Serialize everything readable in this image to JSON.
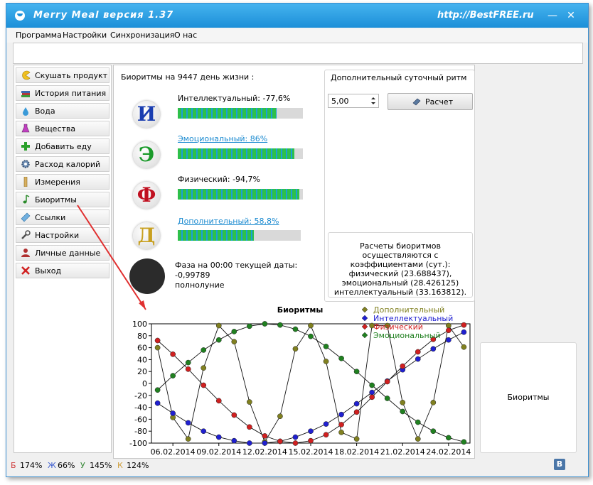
{
  "window": {
    "title": "Merry Meal версия 1.37",
    "watermark": "http://BestFREE.ru",
    "minimize_glyph": "—",
    "close_glyph": "✕"
  },
  "menu": [
    "Программа",
    "Настройки",
    "Синхронизация",
    "О нас"
  ],
  "sidebar": {
    "items": [
      {
        "label": "Скушать продукт",
        "icon": "pacman-icon"
      },
      {
        "label": "История питания",
        "icon": "books-icon"
      },
      {
        "label": "Вода",
        "icon": "water-drop-icon"
      },
      {
        "label": "Вещества",
        "icon": "flask-icon"
      },
      {
        "label": "Добавить еду",
        "icon": "plus-icon"
      },
      {
        "label": "Расход калорий",
        "icon": "gear-icon"
      },
      {
        "label": "Измерения",
        "icon": "ruler-icon"
      },
      {
        "label": "Биоритмы",
        "icon": "music-note-icon"
      },
      {
        "label": "Ссылки",
        "icon": "link-icon"
      },
      {
        "label": "Настройки",
        "icon": "wrench-icon"
      },
      {
        "label": "Личные данные",
        "icon": "user-icon"
      },
      {
        "label": "Выход",
        "icon": "close-x-icon"
      }
    ]
  },
  "biorhythms": {
    "heading": "Биоритмы на 9447 день жизни :",
    "rows": [
      {
        "letter": "И",
        "label": "Интеллектуальный: -77,6%",
        "level": 0.79,
        "color": "#1a3db0"
      },
      {
        "letter": "Э",
        "label": "Эмоциональный: 86%",
        "level": 0.93,
        "color": "#1a9a2a"
      },
      {
        "letter": "Ф",
        "label": "Физический: -94,7%",
        "level": 0.97,
        "color": "#c01020"
      },
      {
        "letter": "Д",
        "label": "Дополнительный: 58,8%",
        "level": 0.62,
        "color": "#c8a020"
      }
    ],
    "phase_line1": "Фаза на 00:00  текущей даты:",
    "phase_line2": "-0,99789",
    "phase_line3": "полнолуние"
  },
  "daily": {
    "title": "Дополнительный суточный ритм",
    "value": "5,00",
    "calc_label": "Расчет",
    "note": "Расчеты биоритмов осуществляются с коэффициентами (сут.): физический (23.688437), эмоциональный (28.426125) интеллектуальный (33.163812)."
  },
  "right_panel": {
    "button_label": "Биоритмы"
  },
  "status": {
    "items": [
      {
        "letter": "Б",
        "value": "174%",
        "color": "#d04040"
      },
      {
        "letter": "Ж",
        "value": "66%",
        "color": "#4060d0"
      },
      {
        "letter": "У",
        "value": "145%",
        "color": "#3a8a3a"
      },
      {
        "letter": "К",
        "value": "124%",
        "color": "#d0a040"
      }
    ],
    "vk_label": "B"
  },
  "chart_data": {
    "type": "line",
    "title": "Биоритмы",
    "ylim": [
      -100,
      100
    ],
    "yticks": [
      100,
      80,
      60,
      40,
      20,
      0,
      -20,
      -40,
      -60,
      -80,
      -100
    ],
    "x_tick_labels": [
      "06.02.2014",
      "09.02.2014",
      "12.02.2014",
      "15.02.2014",
      "18.02.2014",
      "21.02.2014",
      "24.02.2014"
    ],
    "x_tick_days": [
      0,
      3,
      6,
      9,
      12,
      15,
      18
    ],
    "x": [
      -1,
      0,
      1,
      2,
      3,
      4,
      5,
      6,
      7,
      8,
      9,
      10,
      11,
      12,
      13,
      14,
      15,
      16,
      17,
      18,
      19
    ],
    "grid": true,
    "legend_position": "top-right",
    "series": [
      {
        "name": "Дополнительный",
        "color": "#808020",
        "values": [
          60,
          -57,
          -93,
          26,
          97,
          70,
          -31,
          -98,
          -55,
          58,
          97,
          37,
          -82,
          -93,
          97,
          97,
          -32,
          -93,
          -32,
          97,
          61
        ]
      },
      {
        "name": "Интеллектуальный",
        "color": "#2020d0",
        "values": [
          -33,
          -50,
          -66,
          -80,
          -90,
          -96,
          -100,
          -100,
          -97,
          -90,
          -80,
          -68,
          -52,
          -34,
          -15,
          4,
          23,
          41,
          58,
          73,
          86
        ]
      },
      {
        "name": "Физический",
        "color": "#d02020",
        "values": [
          72,
          49,
          24,
          -3,
          -29,
          -53,
          -73,
          -88,
          -97,
          -100,
          -96,
          -86,
          -69,
          -48,
          -23,
          3,
          29,
          53,
          74,
          89,
          98
        ]
      },
      {
        "name": "Эмоциональный",
        "color": "#208020",
        "values": [
          -11,
          13,
          35,
          56,
          73,
          87,
          96,
          100,
          98,
          91,
          79,
          62,
          42,
          20,
          -3,
          -25,
          -47,
          -65,
          -80,
          -91,
          -98
        ]
      }
    ]
  }
}
